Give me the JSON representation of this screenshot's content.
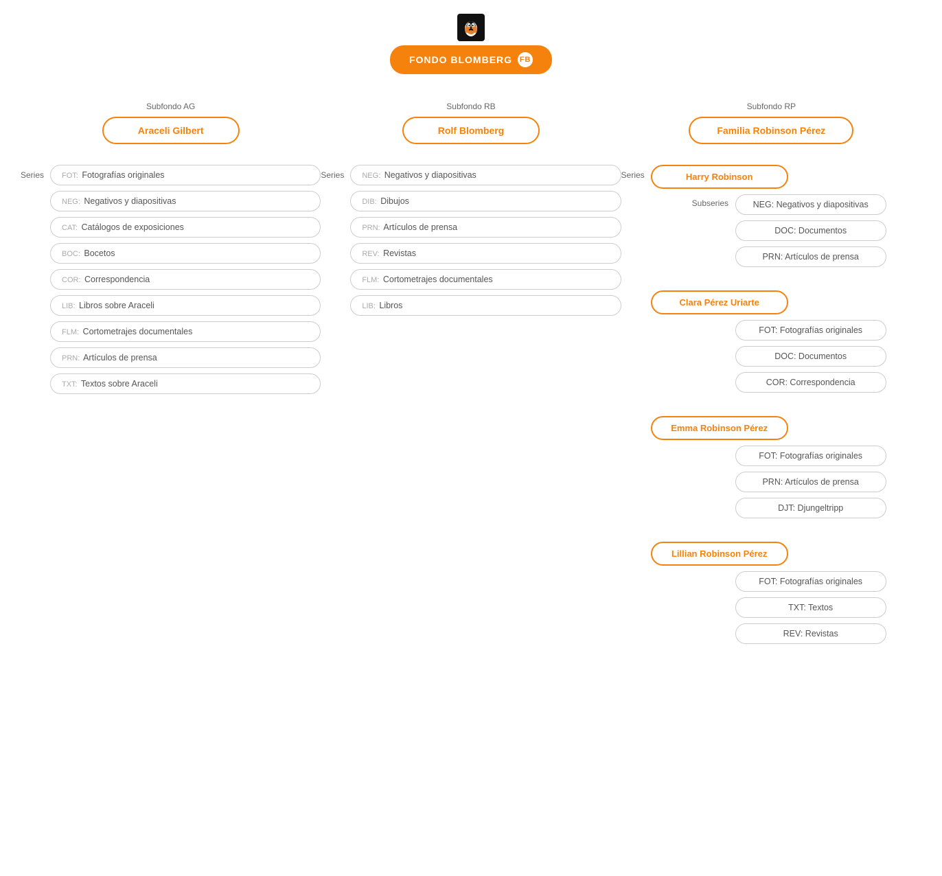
{
  "header": {
    "fondo_label": "FONDO BLOMBERG",
    "fondo_badge": "FB"
  },
  "subfondos": [
    {
      "label": "Subfondo AG",
      "name": "Araceli Gilbert",
      "series_label": "Series",
      "items": [
        {
          "code": "FOT:",
          "text": "Fotografías originales"
        },
        {
          "code": "NEG:",
          "text": "Negativos y diapositivas"
        },
        {
          "code": "CAT:",
          "text": "Catálogos de exposiciones"
        },
        {
          "code": "BOC:",
          "text": "Bocetos"
        },
        {
          "code": "COR:",
          "text": "Correspondencia"
        },
        {
          "code": "LIB:",
          "text": "Libros sobre Araceli"
        },
        {
          "code": "FLM:",
          "text": "Cortometrajes documentales"
        },
        {
          "code": "PRN:",
          "text": "Artículos de prensa"
        },
        {
          "code": "TXT:",
          "text": "Textos sobre Araceli"
        }
      ]
    },
    {
      "label": "Subfondo RB",
      "name": "Rolf Blomberg",
      "series_label": "Series",
      "items": [
        {
          "code": "NEG:",
          "text": "Negativos y diapositivas"
        },
        {
          "code": "DIB:",
          "text": "Dibujos"
        },
        {
          "code": "PRN:",
          "text": "Artículos de prensa"
        },
        {
          "code": "REV:",
          "text": "Revistas"
        },
        {
          "code": "FLM:",
          "text": "Cortometrajes documentales"
        },
        {
          "code": "LIB:",
          "text": "Libros"
        }
      ]
    },
    {
      "label": "Subfondo RP",
      "name": "Familia Robinson Pérez",
      "series_label": "Series",
      "persons": [
        {
          "name": "Harry Robinson",
          "subseries_label": "Subseries",
          "subseries": [
            {
              "code": "NEG:",
              "text": "Negativos y diapositivas"
            },
            {
              "code": "DOC:",
              "text": "Documentos"
            },
            {
              "code": "PRN:",
              "text": "Artículos de prensa"
            }
          ]
        },
        {
          "name": "Clara Pérez Uriarte",
          "subseries_label": "",
          "subseries": [
            {
              "code": "FOT:",
              "text": "Fotografías originales"
            },
            {
              "code": "DOC:",
              "text": "Documentos"
            },
            {
              "code": "COR:",
              "text": "Correspondencia"
            }
          ]
        },
        {
          "name": "Emma Robinson Pérez",
          "subseries_label": "",
          "subseries": [
            {
              "code": "FOT:",
              "text": "Fotografías originales"
            },
            {
              "code": "PRN:",
              "text": "Artículos de prensa"
            },
            {
              "code": "DJT:",
              "text": "Djungeltripp"
            }
          ]
        },
        {
          "name": "Lillian Robinson Pérez",
          "subseries_label": "",
          "subseries": [
            {
              "code": "FOT:",
              "text": "Fotografías originales"
            },
            {
              "code": "TXT:",
              "text": "Textos"
            },
            {
              "code": "REV:",
              "text": "Revistas"
            }
          ]
        }
      ]
    }
  ]
}
